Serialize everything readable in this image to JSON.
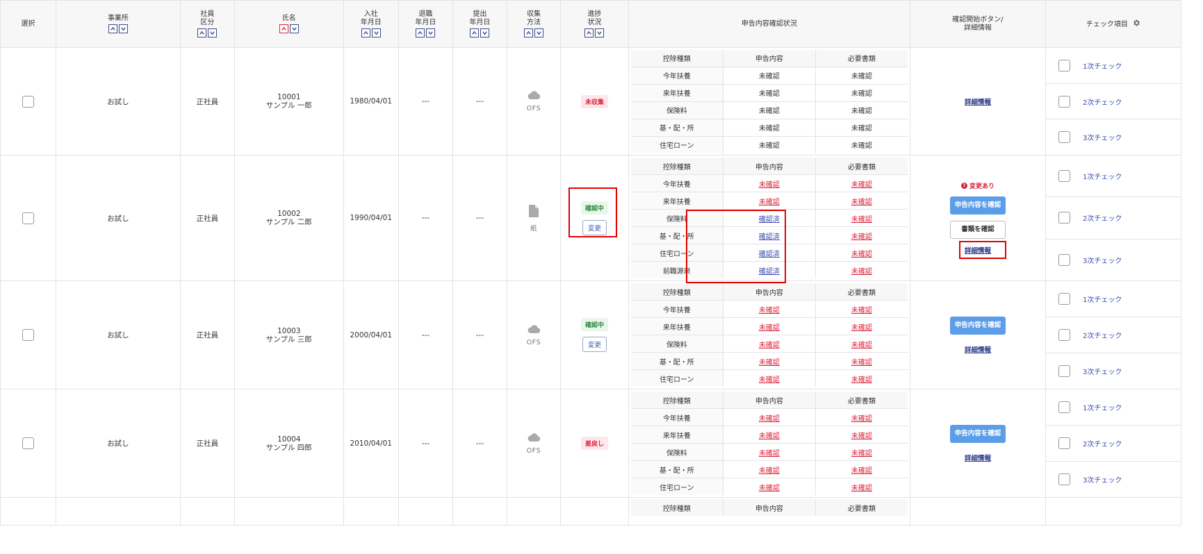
{
  "header": {
    "select": "選択",
    "office": "事業所",
    "employee_type": [
      "社員",
      "区分"
    ],
    "name": "氏名",
    "join_date": [
      "入社",
      "年月日"
    ],
    "leave_date": [
      "退職",
      "年月日"
    ],
    "submit_date": [
      "提出",
      "年月日"
    ],
    "collection_method": [
      "収集",
      "方法"
    ],
    "progress": [
      "進捗",
      "状況"
    ],
    "declaration_status": "申告内容確認状況",
    "confirm_start": [
      "確認開始ボタン/",
      "詳細情報"
    ],
    "check_items": "チェック項目"
  },
  "inner_header": {
    "col1": "控除種類",
    "col2": "申告内容",
    "col3": "必要書類"
  },
  "rows": [
    {
      "office": "お試し",
      "type": "正社員",
      "id": "10001",
      "name": "サンプル 一郎",
      "join": "1980/04/01",
      "leave": "---",
      "submit": "---",
      "method": "OFS",
      "method_icon": "cloud-icon",
      "status": "未収集",
      "status_color": "#d9233a",
      "items": [
        {
          "label": "今年扶養",
          "decl": "未確認",
          "docs": "未確認"
        },
        {
          "label": "来年扶養",
          "decl": "未確認",
          "docs": "未確認"
        },
        {
          "label": "保険料",
          "decl": "未確認",
          "docs": "未確認"
        },
        {
          "label": "基・配・所",
          "decl": "未確認",
          "docs": "未確認"
        },
        {
          "label": "住宅ローン",
          "decl": "未確認",
          "docs": "未確認"
        }
      ],
      "detail": "詳細情報",
      "checks": [
        "1次チェック",
        "2次チェック",
        "3次チェック"
      ]
    },
    {
      "office": "お試し",
      "type": "正社員",
      "id": "10002",
      "name": "サンプル 二郎",
      "join": "1990/04/01",
      "leave": "---",
      "submit": "---",
      "method": "紙",
      "method_icon": "paper-document-icon",
      "status": "確認中",
      "status_color": "#2e8a3e",
      "change": "変更",
      "items": [
        {
          "label": "今年扶養",
          "decl": "未確認",
          "docs": "未確認"
        },
        {
          "label": "来年扶養",
          "decl": "未確認",
          "docs": "未確認"
        },
        {
          "label": "保険料",
          "decl": "確認済",
          "docs": "未確認"
        },
        {
          "label": "基・配・所",
          "decl": "確認済",
          "docs": "未確認"
        },
        {
          "label": "住宅ローン",
          "decl": "確認済",
          "docs": "未確認"
        },
        {
          "label": "前職源泉",
          "decl": "確認済",
          "docs": "未確認"
        }
      ],
      "warning": "変更あり",
      "confirm_button": "申告内容を確認",
      "docs_button": "書類を確認",
      "detail": "詳細情報",
      "checks": [
        "1次チェック",
        "2次チェック",
        "3次チェック"
      ]
    },
    {
      "office": "お試し",
      "type": "正社員",
      "id": "10003",
      "name": "サンプル 三郎",
      "join": "2000/04/01",
      "leave": "---",
      "submit": "---",
      "method": "OFS",
      "method_icon": "cloud-icon",
      "status": "確認中",
      "status_color": "#2e8a3e",
      "change": "変更",
      "items": [
        {
          "label": "今年扶養",
          "decl": "未確認",
          "docs": "未確認"
        },
        {
          "label": "来年扶養",
          "decl": "未確認",
          "docs": "未確認"
        },
        {
          "label": "保険料",
          "decl": "未確認",
          "docs": "未確認"
        },
        {
          "label": "基・配・所",
          "decl": "未確認",
          "docs": "未確認"
        },
        {
          "label": "住宅ローン",
          "decl": "未確認",
          "docs": "未確認"
        }
      ],
      "confirm_button": "申告内容を確認",
      "detail": "詳細情報",
      "checks": [
        "1次チェック",
        "2次チェック",
        "3次チェック"
      ]
    },
    {
      "office": "お試し",
      "type": "正社員",
      "id": "10004",
      "name": "サンプル 四郎",
      "join": "2010/04/01",
      "leave": "---",
      "submit": "---",
      "method": "OFS",
      "method_icon": "cloud-icon",
      "status": "差戻し",
      "status_color": "#d9233a",
      "items": [
        {
          "label": "今年扶養",
          "decl": "未確認",
          "docs": "未確認"
        },
        {
          "label": "来年扶養",
          "decl": "未確認",
          "docs": "未確認"
        },
        {
          "label": "保険料",
          "decl": "未確認",
          "docs": "未確認"
        },
        {
          "label": "基・配・所",
          "decl": "未確認",
          "docs": "未確認"
        },
        {
          "label": "住宅ローン",
          "decl": "未確認",
          "docs": "未確認"
        }
      ],
      "confirm_button": "申告内容を確認",
      "detail": "詳細情報",
      "checks": [
        "1次チェック",
        "2次チェック",
        "3次チェック"
      ]
    }
  ],
  "partial_row": {
    "col1": "控除種類",
    "col2": "申告内容",
    "col3": "必要書類"
  },
  "colors": {
    "unconfirmed_red": "#d9233a",
    "confirmed_blue": "#3a4ab0",
    "primary_button": "#5b9de8",
    "highlight_box": "#e10000"
  }
}
